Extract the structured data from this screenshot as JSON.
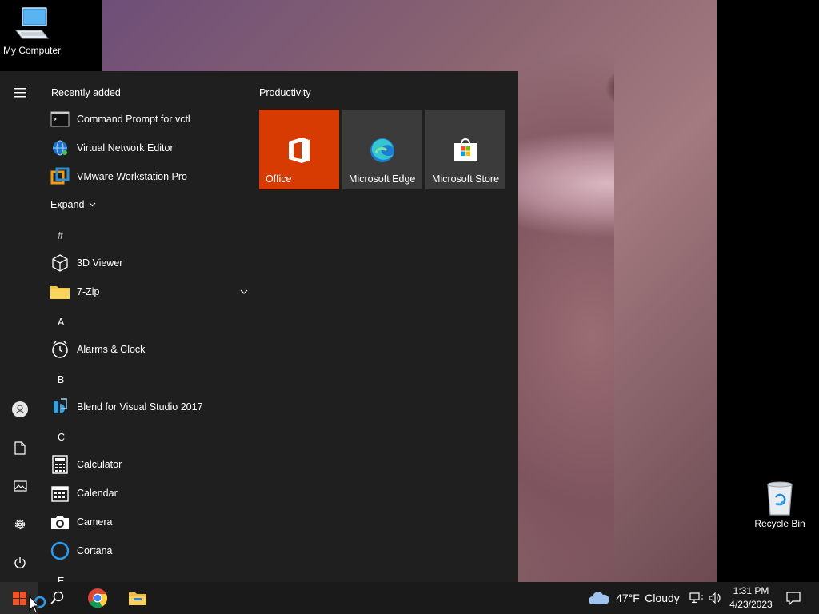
{
  "desktop": {
    "icons": [
      {
        "label": "My Computer"
      },
      {
        "label": "Recycle Bin"
      }
    ]
  },
  "start_menu": {
    "recently_added_title": "Recently added",
    "recent": [
      {
        "label": "Command Prompt for vctl"
      },
      {
        "label": "Virtual Network Editor"
      },
      {
        "label": "VMware Workstation Pro"
      }
    ],
    "expand_label": "Expand",
    "sections": [
      {
        "letter": "#",
        "apps": [
          {
            "label": "3D Viewer"
          },
          {
            "label": "7-Zip"
          }
        ]
      },
      {
        "letter": "A",
        "apps": [
          {
            "label": "Alarms & Clock"
          }
        ]
      },
      {
        "letter": "B",
        "apps": [
          {
            "label": "Blend for Visual Studio 2017"
          }
        ]
      },
      {
        "letter": "C",
        "apps": [
          {
            "label": "Calculator"
          },
          {
            "label": "Calendar"
          },
          {
            "label": "Camera"
          },
          {
            "label": "Cortana"
          }
        ]
      },
      {
        "letter": "E",
        "apps": []
      }
    ],
    "tiles_group": "Productivity",
    "tiles": [
      {
        "label": "Office",
        "color": "#d83b01"
      },
      {
        "label": "Microsoft Edge",
        "color": "#3b3b3b"
      },
      {
        "label": "Microsoft Store",
        "color": "#3b3b3b"
      }
    ]
  },
  "taskbar": {
    "weather": {
      "temp": "47°F",
      "condition": "Cloudy"
    },
    "clock": {
      "time": "1:31 PM",
      "date": "4/23/2023"
    }
  },
  "colors": {
    "start_bg": "#1f1f1f",
    "taskbar_bg": "#1a1a1a",
    "office_tile": "#d83b01",
    "tile_gray": "#3b3b3b"
  }
}
